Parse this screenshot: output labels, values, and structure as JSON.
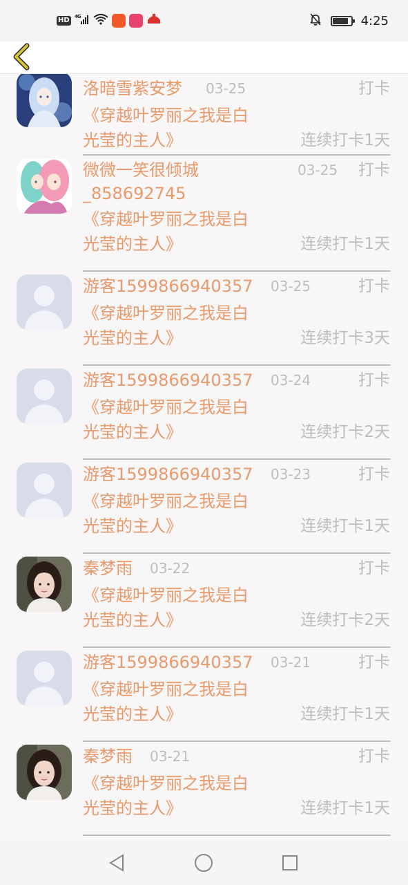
{
  "status_bar": {
    "hd": "HD",
    "signal": "4G",
    "time": "4:25",
    "battery_level": 0.85
  },
  "header": {
    "back_icon": "chevron-left-icon"
  },
  "entries": [
    {
      "name": "洛暗雪紫安梦",
      "name2": "",
      "date": "03-25",
      "checkin": "打卡",
      "book1": "《穿越叶罗丽之我是白",
      "book2": "光莹的主人》",
      "streak": "连续打卡1天",
      "avatar": "anime-blue"
    },
    {
      "name": "微微一笑很倾城",
      "name2": "_858692745",
      "date": "03-25",
      "checkin": "打卡",
      "book1": "《穿越叶罗丽之我是白",
      "book2": "光莹的主人》",
      "streak": "连续打卡1天",
      "avatar": "anime-pink"
    },
    {
      "name": "游客1599866940357",
      "name2": "",
      "date": "03-25",
      "checkin": "打卡",
      "book1": "《穿越叶罗丽之我是白",
      "book2": "光莹的主人》",
      "streak": "连续打卡3天",
      "avatar": "default"
    },
    {
      "name": "游客1599866940357",
      "name2": "",
      "date": "03-24",
      "checkin": "打卡",
      "book1": "《穿越叶罗丽之我是白",
      "book2": "光莹的主人》",
      "streak": "连续打卡2天",
      "avatar": "default"
    },
    {
      "name": "游客1599866940357",
      "name2": "",
      "date": "03-23",
      "checkin": "打卡",
      "book1": "《穿越叶罗丽之我是白",
      "book2": "光莹的主人》",
      "streak": "连续打卡1天",
      "avatar": "default"
    },
    {
      "name": "秦梦雨",
      "name2": "",
      "date": "03-22",
      "checkin": "打卡",
      "book1": "《穿越叶罗丽之我是白",
      "book2": "光莹的主人》",
      "streak": "连续打卡2天",
      "avatar": "photo"
    },
    {
      "name": "游客1599866940357",
      "name2": "",
      "date": "03-21",
      "checkin": "打卡",
      "book1": "《穿越叶罗丽之我是白",
      "book2": "光莹的主人》",
      "streak": "连续打卡1天",
      "avatar": "default"
    },
    {
      "name": "秦梦雨",
      "name2": "",
      "date": "03-21",
      "checkin": "打卡",
      "book1": "《穿越叶罗丽之我是白",
      "book2": "光莹的主人》",
      "streak": "连续打卡1天",
      "avatar": "photo"
    }
  ],
  "nav": {
    "back": "back-triangle-icon",
    "home": "home-circle-icon",
    "recent": "recent-square-icon"
  },
  "colors": {
    "accent": "#e89a6b",
    "muted": "#bdbdbd",
    "back_arrow": "#c9b02a"
  }
}
